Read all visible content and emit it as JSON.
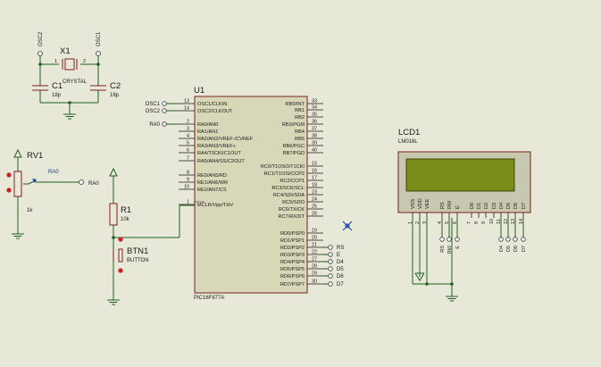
{
  "osc": {
    "top_left_label": "OSC2",
    "top_right_label": "OSC1",
    "crystal_ref": "X1",
    "crystal_value": "CRYSTAL",
    "crystal_pin1": "1",
    "crystal_pin2": "2",
    "c1_ref": "C1",
    "c1_value": "18p",
    "c2_ref": "C2",
    "c2_value": "18p"
  },
  "pot": {
    "ref": "RV1",
    "value": "1k",
    "wiper_label": "RA0",
    "net_label": "RA0"
  },
  "reset": {
    "r1_ref": "R1",
    "r1_value": "10k",
    "btn_ref": "BTN1",
    "btn_value": "BUTTON"
  },
  "mcu": {
    "ref": "U1",
    "part": "PIC16F877A",
    "left_pins": [
      {
        "num": "13",
        "name": "OSC1/CLKIN"
      },
      {
        "num": "14",
        "name": "OSC2/CLKOUT"
      },
      {
        "num": "2",
        "name": "RA0/AN0"
      },
      {
        "num": "3",
        "name": "RA1/AN1"
      },
      {
        "num": "4",
        "name": "RA2/AN2/VREF-/CVREF"
      },
      {
        "num": "5",
        "name": "RA3/AN3/VREF+"
      },
      {
        "num": "6",
        "name": "RA4/T0CKI/C1OUT"
      },
      {
        "num": "7",
        "name": "RA5/AN4/SS/C2OUT"
      },
      {
        "num": "8",
        "name": "RE0/AN5/RD"
      },
      {
        "num": "9",
        "name": "RE1/AN6/WR"
      },
      {
        "num": "10",
        "name": "RE2/AN7/CS"
      },
      {
        "num": "1",
        "name": "MCLR/Vpp/THV"
      }
    ],
    "right_pins": [
      {
        "num": "33",
        "name": "RB0/INT"
      },
      {
        "num": "34",
        "name": "RB1"
      },
      {
        "num": "35",
        "name": "RB2"
      },
      {
        "num": "36",
        "name": "RB3/PGM"
      },
      {
        "num": "37",
        "name": "RB4"
      },
      {
        "num": "38",
        "name": "RB5"
      },
      {
        "num": "39",
        "name": "RB6/PGC"
      },
      {
        "num": "40",
        "name": "RB7/PGD"
      },
      {
        "num": "15",
        "name": "RC0/T1OSO/T1CKI"
      },
      {
        "num": "16",
        "name": "RC1/T1OSI/CCP2"
      },
      {
        "num": "17",
        "name": "RC2/CCP1"
      },
      {
        "num": "18",
        "name": "RC3/SCK/SCL"
      },
      {
        "num": "23",
        "name": "RC4/SDI/SDA"
      },
      {
        "num": "24",
        "name": "RC5/SDO"
      },
      {
        "num": "25",
        "name": "RC6/TX/CK"
      },
      {
        "num": "26",
        "name": "RC7/RX/DT"
      },
      {
        "num": "19",
        "name": "RD0/PSP0"
      },
      {
        "num": "20",
        "name": "RD1/PSP1"
      },
      {
        "num": "21",
        "name": "RD2/PSP2"
      },
      {
        "num": "22",
        "name": "RD3/PSP3"
      },
      {
        "num": "27",
        "name": "RD4/PSP4"
      },
      {
        "num": "28",
        "name": "RD5/PSP5"
      },
      {
        "num": "29",
        "name": "RD6/PSP6"
      },
      {
        "num": "30",
        "name": "RD7/PSP7"
      }
    ],
    "left_nets": [
      "OSC1",
      "OSC2",
      "RA0"
    ],
    "portd_nets": [
      "RS",
      "E",
      "D4",
      "D5",
      "D6",
      "D7"
    ]
  },
  "lcd": {
    "ref": "LCD1",
    "part": "LM016L",
    "pins": [
      {
        "num": "1",
        "name": "VSS",
        "net": ""
      },
      {
        "num": "2",
        "name": "VDD",
        "net": ""
      },
      {
        "num": "3",
        "name": "VEE",
        "net": ""
      },
      {
        "num": "4",
        "name": "RS",
        "net": "RS"
      },
      {
        "num": "5",
        "name": "RW",
        "net": "RW"
      },
      {
        "num": "6",
        "name": "E",
        "net": "E"
      },
      {
        "num": "7",
        "name": "D0",
        "net": ""
      },
      {
        "num": "8",
        "name": "D1",
        "net": ""
      },
      {
        "num": "9",
        "name": "D2",
        "net": ""
      },
      {
        "num": "10",
        "name": "D3",
        "net": ""
      },
      {
        "num": "11",
        "name": "D4",
        "net": "D4"
      },
      {
        "num": "12",
        "name": "D5",
        "net": "D5"
      },
      {
        "num": "13",
        "name": "D6",
        "net": "D6"
      },
      {
        "num": "14",
        "name": "D7",
        "net": "D7"
      }
    ]
  }
}
